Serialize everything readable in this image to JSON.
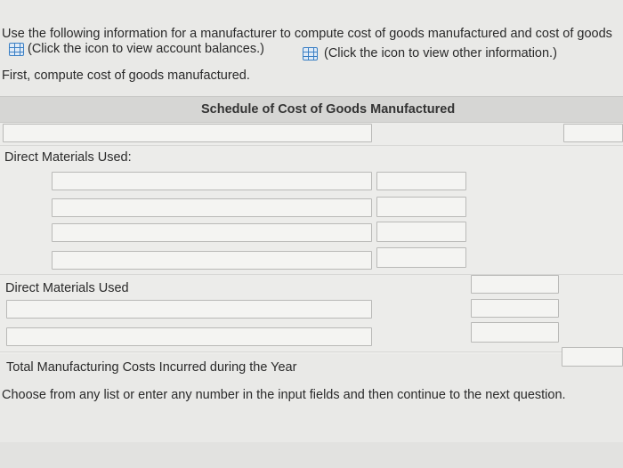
{
  "instructions": {
    "line1": "Use the following information for a manufacturer to compute cost of goods manufactured and cost of goods",
    "link1": "(Click the icon to view account balances.)",
    "link2": "(Click the icon to view other information.)",
    "line3": "First, compute cost of goods manufactured."
  },
  "schedule": {
    "title": "Schedule of Cost of Goods Manufactured",
    "direct_materials_used_heading": "Direct Materials Used:",
    "direct_materials_used_label": "Direct Materials Used",
    "total_label": "Total Manufacturing Costs Incurred during the Year"
  },
  "footer": {
    "hint": "Choose from any list or enter any number in the input fields and then continue to the next question."
  },
  "icons": {
    "balances": "table-grid-icon",
    "other_info": "table-grid-icon"
  },
  "colors": {
    "icon_blue": "#3a7fc4",
    "header_bg": "#d6d6d4"
  }
}
